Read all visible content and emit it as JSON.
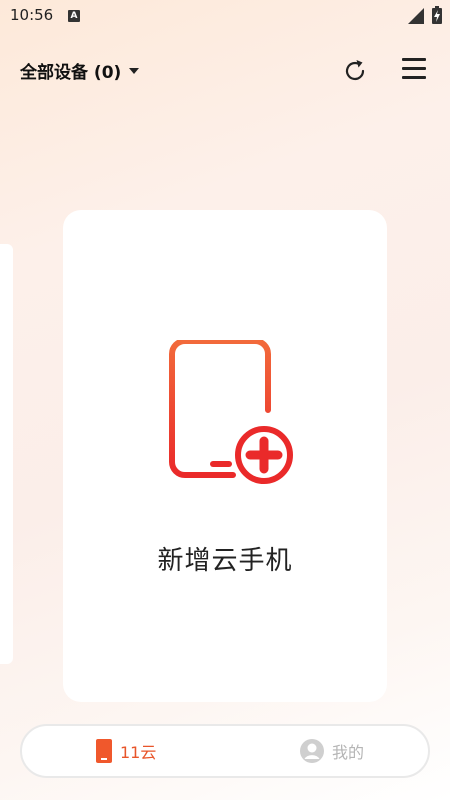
{
  "status_bar": {
    "time": "10:56",
    "notification_icon": "a-icon",
    "signal_icon": "signal-icon",
    "battery_icon": "battery-icon"
  },
  "header": {
    "device_filter": "全部设备 (0)",
    "refresh_icon": "refresh-icon",
    "menu_icon": "menu-icon"
  },
  "card": {
    "title": "新增云手机",
    "icon": "phone-plus-icon"
  },
  "colors": {
    "accent": "#f0582c",
    "inactive": "#b5b5b5"
  },
  "bottom_nav": {
    "tabs": [
      {
        "label": "11云",
        "icon": "cloud-phone-icon",
        "active": true
      },
      {
        "label": "我的",
        "icon": "user-icon",
        "active": false
      }
    ]
  }
}
